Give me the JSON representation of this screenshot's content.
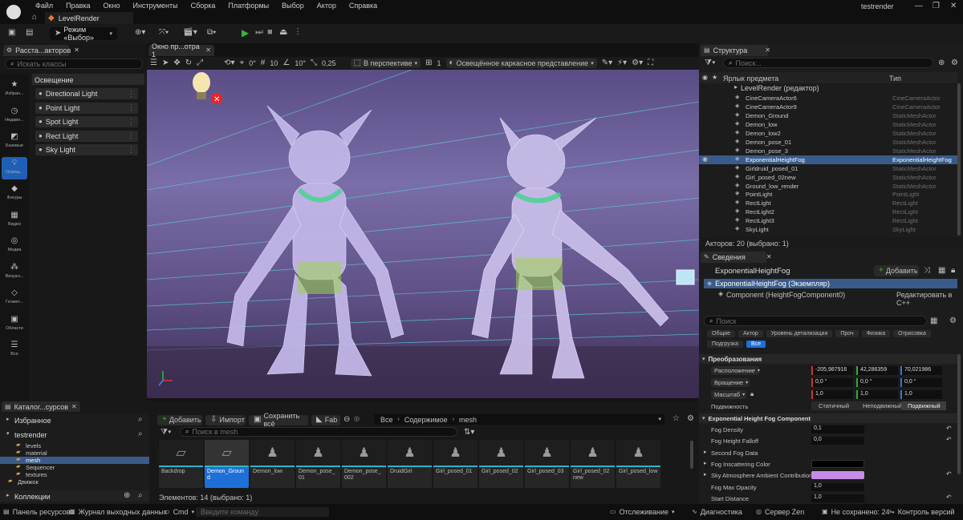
{
  "titlebar": {
    "menus": [
      "Файл",
      "Правка",
      "Окно",
      "Инструменты",
      "Сборка",
      "Платформы",
      "Выбор",
      "Актор",
      "Справка"
    ],
    "project": "testrender",
    "tab": "LevelRender"
  },
  "toolbar": {
    "mode": "Режим «Выбор»"
  },
  "place_actors": {
    "title": "Расста...акторов",
    "search_placeholder": "Искать классы",
    "category": "Освещение",
    "categories": [
      {
        "label": "Избран...",
        "icon": "star-icon"
      },
      {
        "label": "Недавн...",
        "icon": "clock-icon"
      },
      {
        "label": "Базовые",
        "icon": "cube-icon"
      },
      {
        "label": "Освещ...",
        "icon": "bulb-icon"
      },
      {
        "label": "Фигуры",
        "icon": "shapes-icon"
      },
      {
        "label": "Видео",
        "icon": "film-icon"
      },
      {
        "label": "Медиа",
        "icon": "media-icon"
      },
      {
        "label": "Визуал...",
        "icon": "visual-icon"
      },
      {
        "label": "Геомет...",
        "icon": "geometry-icon"
      },
      {
        "label": "Области",
        "icon": "volume-icon"
      },
      {
        "label": "Все",
        "icon": "all-icon"
      }
    ],
    "items": [
      "Directional Light",
      "Point Light",
      "Spot Light",
      "Rect Light",
      "Sky Light"
    ]
  },
  "viewport": {
    "tab": "Окно пр...отра 1",
    "angle": "0°",
    "grid": "10",
    "rotate": "10°",
    "scale": "0,25",
    "view": "В перспективе",
    "view_mode": "Освещённое каркасное представление",
    "camera_speed": "1"
  },
  "outliner": {
    "title": "Структура",
    "search_placeholder": "Поиск...",
    "col_label": "Ярлык предмета",
    "col_type": "Тип",
    "level": "LevelRender (редактор)",
    "rows": [
      {
        "name": "CineCameraActor6",
        "type": "CineCameraActor"
      },
      {
        "name": "CineCameraActor9",
        "type": "CineCameraActor"
      },
      {
        "name": "Demon_Ground",
        "type": "StaticMeshActor"
      },
      {
        "name": "Demon_low",
        "type": "StaticMeshActor"
      },
      {
        "name": "Demon_low2",
        "type": "StaticMeshActor"
      },
      {
        "name": "Demon_pose_01",
        "type": "StaticMeshActor"
      },
      {
        "name": "Demon_pose_3",
        "type": "StaticMeshActor"
      },
      {
        "name": "ExponentialHeightFog",
        "type": "ExponentialHeightFog"
      },
      {
        "name": "Girldruid_posed_01",
        "type": "StaticMeshActor"
      },
      {
        "name": "Girl_posed_02new",
        "type": "StaticMeshActor"
      },
      {
        "name": "Ground_low_render",
        "type": "StaticMeshActor"
      },
      {
        "name": "PointLight",
        "type": "PointLight"
      },
      {
        "name": "RectLight",
        "type": "RectLight"
      },
      {
        "name": "RectLight2",
        "type": "RectLight"
      },
      {
        "name": "RectLight3",
        "type": "RectLight"
      },
      {
        "name": "SkyLight",
        "type": "SkyLight"
      }
    ],
    "footer": "Акторов: 20 (выбрано: 1)"
  },
  "details": {
    "title": "Сведения",
    "actor": "ExponentialHeightFog",
    "add_label": "Добавить",
    "instance": "ExponentialHeightFog (Экземпляр)",
    "component": "Component (HeightFogComponent0)",
    "edit_cpp": "Редактировать в C++",
    "search_placeholder": "Поиск",
    "filters_row1": [
      "Общие",
      "Актор",
      "Уровень детализации",
      "Проч",
      "Физика",
      "Отрисовка"
    ],
    "filters_row2": [
      "Подгрузка",
      "Все"
    ],
    "transform_header": "Преобразования",
    "location": {
      "label": "Расположение",
      "x": "-205,987916",
      "y": "42,286359",
      "z": "70,021986"
    },
    "rotation": {
      "label": "Вращение",
      "x": "0,0 °",
      "y": "0,0 °",
      "z": "0,0 °"
    },
    "scale": {
      "label": "Масштаб",
      "x": "1,0",
      "y": "1,0",
      "z": "1,0"
    },
    "mobility": {
      "label": "Подвижность",
      "options": [
        "Статичный",
        "Неподвижный",
        "Подвижный"
      ]
    },
    "fog_header": "Exponential Height Fog Component",
    "fog_density": {
      "label": "Fog Density",
      "value": "0,1"
    },
    "fog_falloff": {
      "label": "Fog Height Falloff",
      "value": "0,0"
    },
    "second_fog": "Second Fog Data",
    "inscatter": {
      "label": "Fog Inscattering Color",
      "color": "#000000"
    },
    "sky_atmo": {
      "label": "Sky Atmosphere Ambient Contribution Col...",
      "color": "#c58ce6"
    },
    "max_opacity": {
      "label": "Fog Max Opacity",
      "value": "1,0"
    },
    "start_distance": {
      "label": "Start Distance",
      "value": "1,0"
    }
  },
  "content": {
    "title": "Каталог...сурсов",
    "favorites": "Избранное",
    "project": "testrender",
    "folders": [
      "levels",
      "material",
      "mesh",
      "Sequencer",
      "textures",
      "Движок"
    ],
    "collections": "Коллекции",
    "add": "Добавить",
    "import": "Импорт",
    "save_all": "Сохранить всё",
    "fab": "Fab",
    "path": [
      "Все",
      "Содержимое",
      "mesh"
    ],
    "search_placeholder": "Поиск в mesh",
    "assets": [
      "Backdrop",
      "Demon_Ground",
      "Demon_low",
      "Demon_pose_01",
      "Demon_pose_002",
      "DruidGirl",
      "Girl_posed_01",
      "Girl_posed_02",
      "Girl_posed_03",
      "Girl_posed_02new",
      "Girl_posed_low"
    ],
    "footer": "Элементов: 14 (выбрано: 1)"
  },
  "statusbar": {
    "resources": "Панель ресурсов",
    "output": "Журнал выходных данных",
    "cmd": "Cmd",
    "cmd_placeholder": "Введите команду",
    "tracking": "Отслеживание",
    "diagnostics": "Диагностика",
    "zen": "Сервер Zen",
    "unsaved": "Не сохранено: 24",
    "vcs": "Контроль версий"
  }
}
